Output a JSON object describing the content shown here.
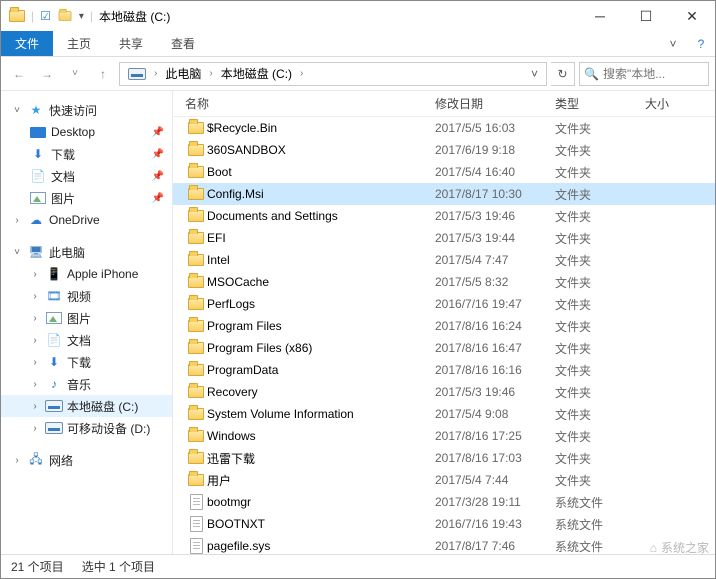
{
  "title": "本地磁盘 (C:)",
  "ribbon": {
    "file": "文件",
    "tabs": [
      "主页",
      "共享",
      "查看"
    ]
  },
  "breadcrumb": {
    "pc": "此电脑",
    "loc": "本地磁盘 (C:)"
  },
  "search": {
    "placeholder": "搜索\"本地..."
  },
  "columns": {
    "name": "名称",
    "date": "修改日期",
    "type": "类型",
    "size": "大小"
  },
  "side": {
    "quick": "快速访问",
    "quick_items": [
      {
        "label": "Desktop",
        "icon": "desktop",
        "pin": true
      },
      {
        "label": "下载",
        "icon": "download",
        "pin": true
      },
      {
        "label": "文档",
        "icon": "doc",
        "pin": true
      },
      {
        "label": "图片",
        "icon": "pic",
        "pin": true
      }
    ],
    "onedrive": "OneDrive",
    "thispc": "此电脑",
    "pc_items": [
      {
        "label": "Apple iPhone",
        "icon": "phone"
      },
      {
        "label": "视频",
        "icon": "video"
      },
      {
        "label": "图片",
        "icon": "pic"
      },
      {
        "label": "文档",
        "icon": "doc"
      },
      {
        "label": "下载",
        "icon": "download"
      },
      {
        "label": "音乐",
        "icon": "music"
      },
      {
        "label": "本地磁盘 (C:)",
        "icon": "drive",
        "selected": true
      },
      {
        "label": "可移动设备 (D:)",
        "icon": "drive"
      }
    ],
    "network": "网络"
  },
  "files": [
    {
      "name": "$Recycle.Bin",
      "date": "2017/5/5 16:03",
      "type": "文件夹",
      "icon": "folder"
    },
    {
      "name": "360SANDBOX",
      "date": "2017/6/19 9:18",
      "type": "文件夹",
      "icon": "folder"
    },
    {
      "name": "Boot",
      "date": "2017/5/4 16:40",
      "type": "文件夹",
      "icon": "folder"
    },
    {
      "name": "Config.Msi",
      "date": "2017/8/17 10:30",
      "type": "文件夹",
      "icon": "folder",
      "selected": true
    },
    {
      "name": "Documents and Settings",
      "date": "2017/5/3 19:46",
      "type": "文件夹",
      "icon": "folder"
    },
    {
      "name": "EFI",
      "date": "2017/5/3 19:44",
      "type": "文件夹",
      "icon": "folder"
    },
    {
      "name": "Intel",
      "date": "2017/5/4 7:47",
      "type": "文件夹",
      "icon": "folder"
    },
    {
      "name": "MSOCache",
      "date": "2017/5/5 8:32",
      "type": "文件夹",
      "icon": "folder"
    },
    {
      "name": "PerfLogs",
      "date": "2016/7/16 19:47",
      "type": "文件夹",
      "icon": "folder"
    },
    {
      "name": "Program Files",
      "date": "2017/8/16 16:24",
      "type": "文件夹",
      "icon": "folder"
    },
    {
      "name": "Program Files (x86)",
      "date": "2017/8/16 16:47",
      "type": "文件夹",
      "icon": "folder"
    },
    {
      "name": "ProgramData",
      "date": "2017/8/16 16:16",
      "type": "文件夹",
      "icon": "folder"
    },
    {
      "name": "Recovery",
      "date": "2017/5/3 19:46",
      "type": "文件夹",
      "icon": "folder"
    },
    {
      "name": "System Volume Information",
      "date": "2017/5/4 9:08",
      "type": "文件夹",
      "icon": "folder"
    },
    {
      "name": "Windows",
      "date": "2017/8/16 17:25",
      "type": "文件夹",
      "icon": "folder"
    },
    {
      "name": "迅雷下载",
      "date": "2017/8/16 17:03",
      "type": "文件夹",
      "icon": "folder"
    },
    {
      "name": "用户",
      "date": "2017/5/4 7:44",
      "type": "文件夹",
      "icon": "folder"
    },
    {
      "name": "bootmgr",
      "date": "2017/3/28 19:11",
      "type": "系统文件",
      "icon": "file"
    },
    {
      "name": "BOOTNXT",
      "date": "2016/7/16 19:43",
      "type": "系统文件",
      "icon": "file"
    },
    {
      "name": "pagefile.sys",
      "date": "2017/8/17 7:46",
      "type": "系统文件",
      "icon": "file"
    }
  ],
  "status": {
    "count": "21 个项目",
    "selected": "选中 1 个项目"
  },
  "watermark": "系统之家"
}
